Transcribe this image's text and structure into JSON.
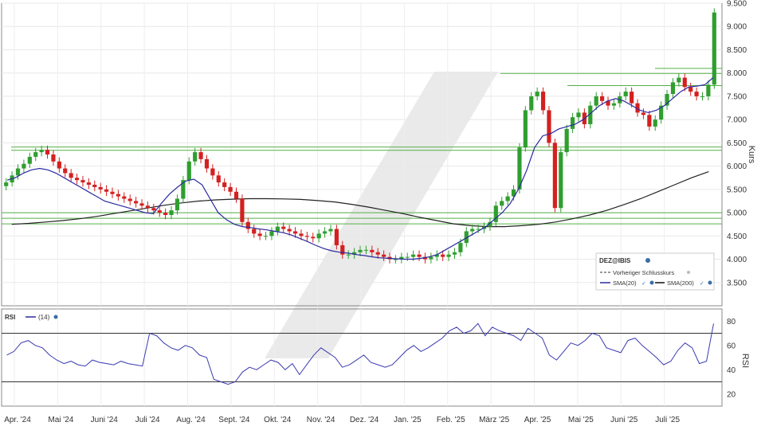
{
  "chart_data": [
    {
      "type": "candlestick",
      "instrument": "DEZ@IBIS",
      "ylabel": "Kurs",
      "ylim": [
        3000,
        9500
      ],
      "yticks": [
        3500,
        4000,
        4500,
        5000,
        5500,
        6000,
        6500,
        7000,
        7500,
        8000,
        8500,
        9000,
        9500
      ],
      "ytick_labels": [
        "3.500",
        "4.000",
        "4.500",
        "5.000",
        "5.500",
        "6.000",
        "6.500",
        "7.000",
        "7.500",
        "8.000",
        "8.500",
        "9.000",
        "9.500"
      ],
      "grid": true,
      "x_labels": [
        "Apr. '24",
        "Mai '24",
        "Juni '24",
        "Juli '24",
        "Aug. '24",
        "Sept. '24",
        "Okt. '24",
        "Nov. '24",
        "Dez. '24",
        "Jan. '25",
        "Feb. '25",
        "März '25",
        "Apr. '25",
        "Mai '25",
        "Juni '25",
        "Juli '25"
      ],
      "legend": {
        "position": "bottom-right",
        "title": "DEZ@IBIS",
        "items": [
          "Vorheriger Schlusskurs",
          "SMA(20)",
          "SMA(200)"
        ]
      },
      "horizontal_lines": [
        8100,
        7990,
        7730,
        6410,
        6340,
        5000,
        4880,
        4760
      ],
      "series": [
        {
          "name": "DEZ@IBIS",
          "close": [
            5650,
            5800,
            5950,
            6050,
            6200,
            6300,
            6350,
            6250,
            6100,
            5950,
            5850,
            5750,
            5700,
            5650,
            5600,
            5550,
            5500,
            5450,
            5400,
            5350,
            5300,
            5250,
            5200,
            5150,
            5100,
            5050,
            5000,
            4950,
            5050,
            5300,
            5700,
            6100,
            6300,
            6150,
            5950,
            5800,
            5650,
            5550,
            5450,
            5300,
            4800,
            4650,
            4550,
            4500,
            4500,
            4600,
            4700,
            4650,
            4600,
            4550,
            4500,
            4480,
            4450,
            4550,
            4600,
            4650,
            4300,
            4100,
            4100,
            4150,
            4200,
            4200,
            4150,
            4100,
            4050,
            4000,
            4000,
            4050,
            4050,
            4100,
            4050,
            4000,
            4050,
            4100,
            4050,
            4100,
            4150,
            4350,
            4600,
            4650,
            4650,
            4700,
            4800,
            5150,
            5250,
            5350,
            5500,
            6400,
            7200,
            7500,
            7600,
            7200,
            6500,
            5100,
            6300,
            6800,
            7050,
            7150,
            6900,
            7300,
            7500,
            7400,
            7300,
            7350,
            7500,
            7600,
            7350,
            7150,
            7100,
            6850,
            7000,
            7300,
            7550,
            7800,
            7900,
            7700,
            7600,
            7500,
            7500,
            7750,
            9300
          ]
        },
        {
          "name": "SMA(20)",
          "values": [
            5700,
            5750,
            5850,
            5920,
            5950,
            5920,
            5850,
            5750,
            5650,
            5550,
            5450,
            5350,
            5250,
            5200,
            5150,
            5100,
            5050,
            5000,
            4980,
            5200,
            5400,
            5550,
            5680,
            5720,
            5600,
            5300,
            5000,
            4850,
            4750,
            4700,
            4680,
            4650,
            4630,
            4600,
            4570,
            4520,
            4450,
            4380,
            4300,
            4230,
            4180,
            4150,
            4130,
            4100,
            4080,
            4050,
            4030,
            4020,
            4010,
            4000,
            4000,
            4020,
            4050,
            4100,
            4200,
            4300,
            4400,
            4500,
            4600,
            4700,
            4850,
            5000,
            5200,
            5500,
            5900,
            6400,
            6650,
            6700,
            6800,
            6850,
            6900,
            7000,
            7150,
            7300,
            7400,
            7450,
            7400,
            7300,
            7200,
            7150,
            7200,
            7300,
            7450,
            7600,
            7700,
            7720,
            7750,
            7900
          ]
        },
        {
          "name": "SMA(200)",
          "values": [
            4750,
            4770,
            4800,
            4830,
            4870,
            4920,
            4980,
            5040,
            5100,
            5160,
            5210,
            5250,
            5275,
            5290,
            5300,
            5300,
            5295,
            5285,
            5260,
            5230,
            5180,
            5120,
            5050,
            4980,
            4900,
            4830,
            4760,
            4720,
            4700,
            4700,
            4720,
            4750,
            4800,
            4870,
            4950,
            5050,
            5170,
            5300,
            5450,
            5600,
            5750,
            5880
          ]
        }
      ]
    },
    {
      "type": "line",
      "ylabel": "RSI",
      "title": "RSI",
      "series_label": "(14)",
      "ylim": [
        10,
        90
      ],
      "yticks": [
        20,
        40,
        60,
        80
      ],
      "reference_lines": [
        30,
        70
      ],
      "series": [
        {
          "name": "(14)",
          "values": [
            52,
            55,
            62,
            64,
            60,
            58,
            52,
            48,
            45,
            47,
            44,
            43,
            48,
            46,
            45,
            44,
            47,
            45,
            44,
            43,
            70,
            68,
            62,
            58,
            56,
            60,
            58,
            52,
            50,
            32,
            30,
            28,
            30,
            38,
            42,
            40,
            44,
            48,
            46,
            40,
            45,
            36,
            44,
            52,
            58,
            54,
            50,
            42,
            44,
            48,
            52,
            46,
            44,
            42,
            44,
            50,
            56,
            60,
            55,
            58,
            62,
            66,
            72,
            75,
            70,
            72,
            78,
            68,
            75,
            72,
            70,
            68,
            64,
            74,
            70,
            66,
            52,
            48,
            55,
            62,
            60,
            64,
            70,
            68,
            58,
            56,
            54,
            64,
            66,
            60,
            55,
            50,
            44,
            47,
            56,
            62,
            58,
            45,
            47,
            78
          ]
        }
      ]
    }
  ]
}
